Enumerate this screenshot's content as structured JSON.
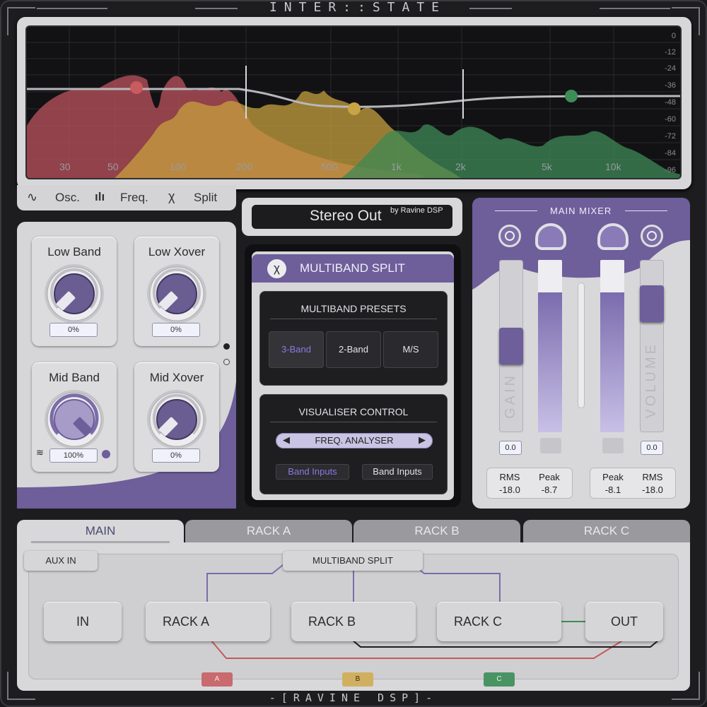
{
  "window": {
    "title": "INTER::STATE",
    "brand": "-[RAVINE DSP]-"
  },
  "analyser": {
    "db_labels": [
      "0",
      "-12",
      "-24",
      "-36",
      "-48",
      "-60",
      "-72",
      "-84",
      "-96"
    ],
    "freq_labels": [
      "30",
      "50",
      "100",
      "200",
      "500",
      "1k",
      "2k",
      "5k",
      "10k"
    ]
  },
  "view_tabs": {
    "osc": "Osc.",
    "freq": "Freq.",
    "split": "Split"
  },
  "knobs": [
    {
      "label": "Low Band",
      "value": "0%",
      "level": 0
    },
    {
      "label": "Low Xover",
      "value": "0%",
      "level": 0
    },
    {
      "label": "Mid Band",
      "value": "100%",
      "level": 1
    },
    {
      "label": "Mid Xover",
      "value": "0%",
      "level": 0
    }
  ],
  "output": {
    "title": "Stereo Out",
    "by": "by Ravine DSP"
  },
  "multiband": {
    "title": "MULTIBAND SPLIT",
    "icon": "split-icon",
    "presets_title": "MULTIBAND PRESETS",
    "presets": [
      "3-Band",
      "2-Band",
      "M/S"
    ],
    "active_preset": "3-Band",
    "visualiser_title": "VISUALISER CONTROL",
    "visualiser_mode": "FREQ. ANALYSER",
    "band_inputs_a": "Band Inputs",
    "band_inputs_b": "Band Inputs"
  },
  "mixer": {
    "title": "MAIN MIXER",
    "gain_label": "GAIN",
    "volume_label": "VOLUME",
    "gain_value": "0.0",
    "volume_value": "0.0",
    "left_stats": {
      "rms_label": "RMS",
      "rms": "-18.0",
      "peak_label": "Peak",
      "peak": "-8.7"
    },
    "right_stats": {
      "peak_label": "Peak",
      "peak": "-8.1",
      "rms_label": "RMS",
      "rms": "-18.0"
    }
  },
  "routing": {
    "tabs": [
      "MAIN",
      "RACK A",
      "RACK B",
      "RACK C"
    ],
    "active_tab": "MAIN",
    "aux_in": "AUX IN",
    "split": "MULTIBAND SPLIT",
    "nodes": [
      "IN",
      "RACK A",
      "RACK B",
      "RACK C",
      "OUT"
    ],
    "tags": [
      "A",
      "B",
      "C"
    ]
  },
  "colors": {
    "accent": "#6e5e9a",
    "band_low": "#c45a5a",
    "band_mid": "#c8a040",
    "band_high": "#3f8a55"
  }
}
